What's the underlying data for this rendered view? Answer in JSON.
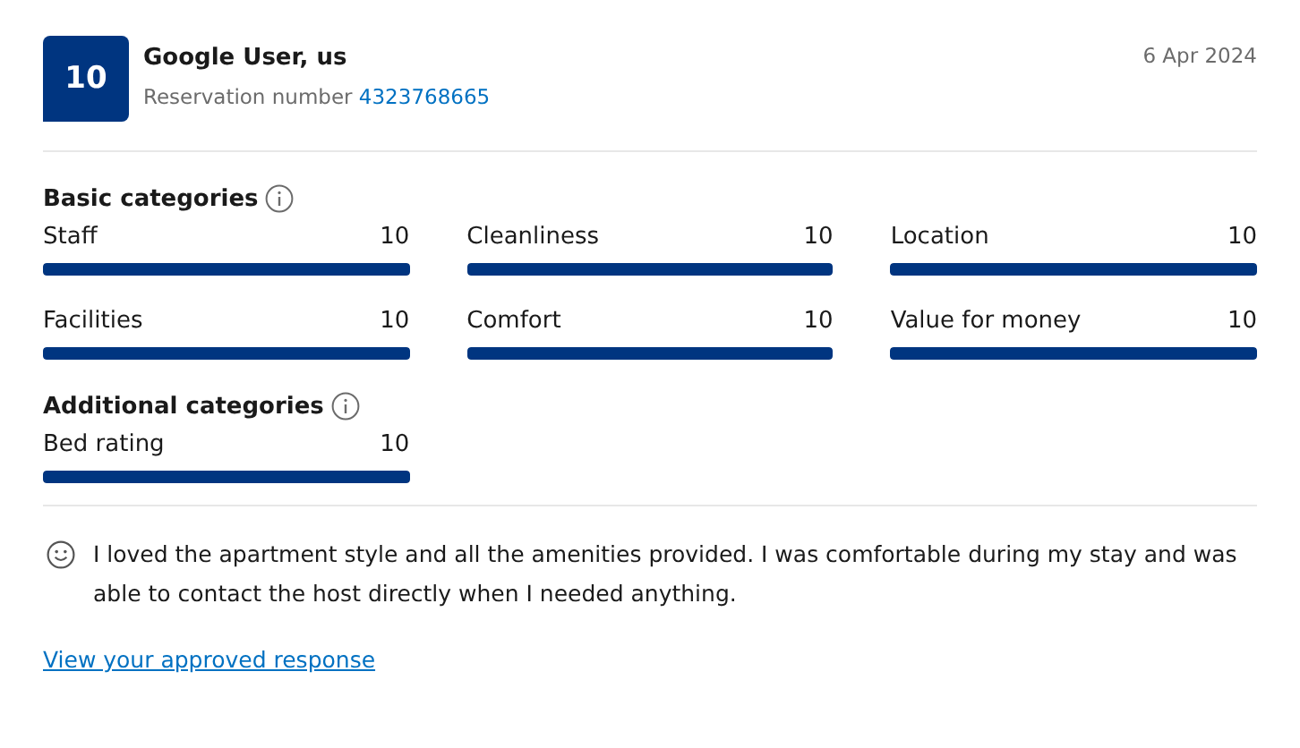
{
  "review": {
    "score": "10",
    "reviewer": "Google User, us",
    "reservation_label": "Reservation number",
    "reservation_number": "4323768665",
    "date": "6 Apr 2024"
  },
  "sections": [
    {
      "title": "Basic categories",
      "ratings": [
        {
          "label": "Staff",
          "value": "10",
          "level": 1
        },
        {
          "label": "Cleanliness",
          "value": "10",
          "level": 1
        },
        {
          "label": "Location",
          "value": "10",
          "level": 1
        },
        {
          "label": "Facilities",
          "value": "10",
          "level": 1
        },
        {
          "label": "Comfort",
          "value": "10",
          "level": 1
        },
        {
          "label": "Value for money",
          "value": "10",
          "level": 1
        }
      ]
    },
    {
      "title": "Additional categories",
      "ratings": [
        {
          "label": "Bed rating",
          "value": "10",
          "level": 1
        }
      ]
    }
  ],
  "comment": {
    "text": "I loved the apartment style and all the amenities provided. I was comfortable during my stay and was able to contact the host directly when I needed anything."
  },
  "link": "View your approved response"
}
